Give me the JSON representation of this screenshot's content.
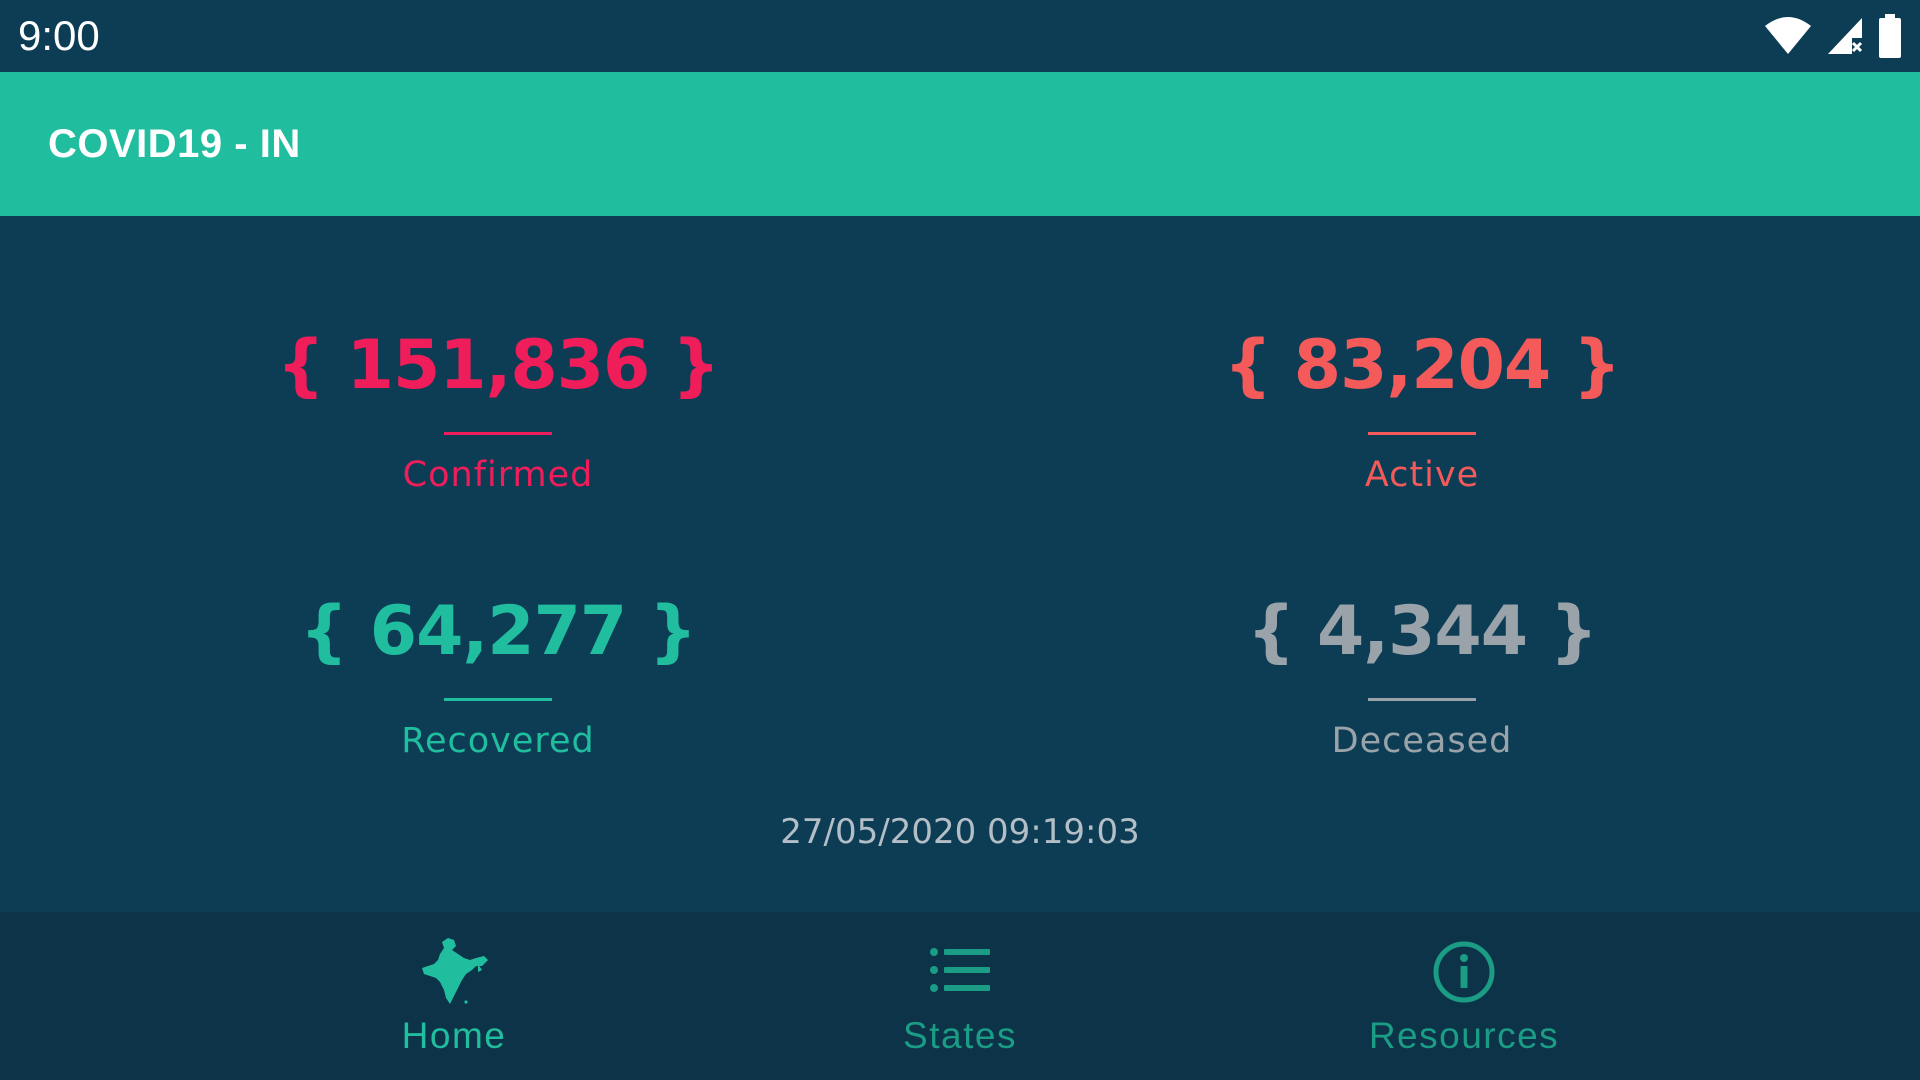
{
  "status_bar": {
    "time": "9:00"
  },
  "app_bar": {
    "title": "COVID19 - IN"
  },
  "stats": {
    "confirmed": {
      "value": "{ 151,836 }",
      "label": "Confirmed",
      "color": "#f01d5b"
    },
    "active": {
      "value": "{ 83,204 }",
      "label": "Active",
      "color": "#f45a5a"
    },
    "recovered": {
      "value": "{ 64,277 }",
      "label": "Recovered",
      "color": "#21bd9f"
    },
    "deceased": {
      "value": "{ 4,344 }",
      "label": "Deceased",
      "color": "#9aa3aa"
    }
  },
  "timestamp": "27/05/2020 09:19:03",
  "bottom_nav": {
    "items": [
      {
        "label": "Home",
        "icon": "india-map-icon",
        "active": true
      },
      {
        "label": "States",
        "icon": "list-icon",
        "active": false
      },
      {
        "label": "Resources",
        "icon": "info-icon",
        "active": false
      }
    ],
    "active_color": "#21bd9f",
    "inactive_color": "#1a9c85"
  },
  "theme": {
    "background": "#0c3d55",
    "app_bar": "#21bd9f",
    "nav_background": "#0c3347"
  }
}
